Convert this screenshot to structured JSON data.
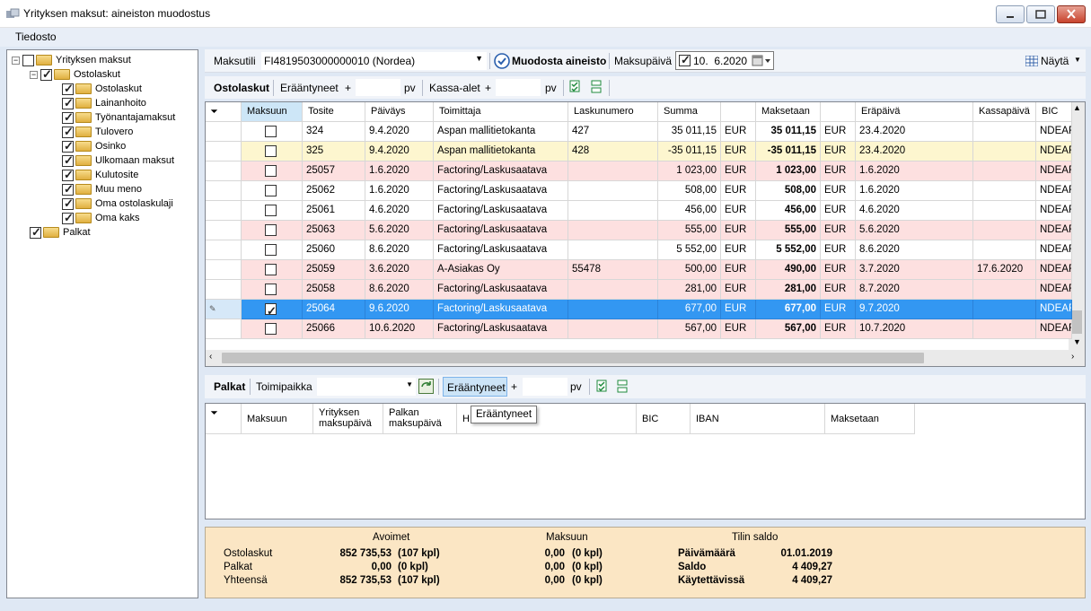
{
  "window": {
    "title": "Yrityksen maksut: aineiston muodostus"
  },
  "menu": {
    "file": "Tiedosto"
  },
  "tree": [
    {
      "label": "Yrityksen maksut",
      "checked": false,
      "level": 0,
      "expander": "−"
    },
    {
      "label": "Ostolaskut",
      "checked": true,
      "level": 1,
      "expander": "−"
    },
    {
      "label": "Ostolaskut",
      "checked": true,
      "level": 2
    },
    {
      "label": "Lainanhoito",
      "checked": true,
      "level": 2
    },
    {
      "label": "Työnantajamaksut",
      "checked": true,
      "level": 2
    },
    {
      "label": "Tulovero",
      "checked": true,
      "level": 2
    },
    {
      "label": "Osinko",
      "checked": true,
      "level": 2
    },
    {
      "label": "Ulkomaan maksut",
      "checked": true,
      "level": 2
    },
    {
      "label": "Kulutosite",
      "checked": true,
      "level": 2
    },
    {
      "label": "Muu meno",
      "checked": true,
      "level": 2
    },
    {
      "label": "Oma ostolaskulaji",
      "checked": true,
      "level": 2
    },
    {
      "label": "Oma kaks",
      "checked": true,
      "level": 2
    },
    {
      "label": "Palkat",
      "checked": true,
      "level": 1
    }
  ],
  "top": {
    "account_label": "Maksutili",
    "account_value": "FI4819503000000010 (Nordea)",
    "create_label": "Muodosta aineisto",
    "paydate_label": "Maksupäivä",
    "paydate_value": "10.  6.2020",
    "show_label": "Näytä"
  },
  "purchases": {
    "section_label": "Ostolaskut",
    "overdue_label": "Erääntyneet",
    "plus": "+",
    "pv": "pv",
    "discount_label": "Kassa-alet",
    "plus2": "+",
    "pv2": "pv",
    "columns": [
      "Maksuun",
      "Tosite",
      "Päiväys",
      "Toimittaja",
      "Laskunumero",
      "Summa",
      "",
      "Maksetaan",
      "",
      "Eräpäivä",
      "Kassapäivä",
      "BIC"
    ],
    "rows": [
      {
        "checked": false,
        "doc": "324",
        "date": "9.4.2020",
        "supplier": "Aspan mallitietokanta",
        "invoice": "427",
        "sum": "35 011,15",
        "cur": "EUR",
        "pay": "35 011,15",
        "cur2": "EUR",
        "due": "23.4.2020",
        "cash": "",
        "bic": "NDEAFIHH",
        "style": "white",
        "due_red": true
      },
      {
        "checked": false,
        "doc": "325",
        "date": "9.4.2020",
        "supplier": "Aspan mallitietokanta",
        "invoice": "428",
        "sum": "-35 011,15",
        "cur": "EUR",
        "pay": "-35 011,15",
        "cur2": "EUR",
        "due": "23.4.2020",
        "cash": "",
        "bic": "NDEAFIHH",
        "style": "yellow",
        "due_red": true
      },
      {
        "checked": false,
        "doc": "25057",
        "date": "1.6.2020",
        "supplier": "Factoring/Laskusaatava",
        "invoice": "",
        "sum": "1 023,00",
        "cur": "EUR",
        "pay": "1 023,00",
        "cur2": "EUR",
        "due": "1.6.2020",
        "cash": "",
        "bic": "NDEAFIHH",
        "style": "pink",
        "due_red": true
      },
      {
        "checked": false,
        "doc": "25062",
        "date": "1.6.2020",
        "supplier": "Factoring/Laskusaatava",
        "invoice": "",
        "sum": "508,00",
        "cur": "EUR",
        "pay": "508,00",
        "cur2": "EUR",
        "due": "1.6.2020",
        "cash": "",
        "bic": "NDEAFIHH",
        "style": "white",
        "due_red": true
      },
      {
        "checked": false,
        "doc": "25061",
        "date": "4.6.2020",
        "supplier": "Factoring/Laskusaatava",
        "invoice": "",
        "sum": "456,00",
        "cur": "EUR",
        "pay": "456,00",
        "cur2": "EUR",
        "due": "4.6.2020",
        "cash": "",
        "bic": "NDEAFIHH",
        "style": "white",
        "due_red": true
      },
      {
        "checked": false,
        "doc": "25063",
        "date": "5.6.2020",
        "supplier": "Factoring/Laskusaatava",
        "invoice": "",
        "sum": "555,00",
        "cur": "EUR",
        "pay": "555,00",
        "cur2": "EUR",
        "due": "5.6.2020",
        "cash": "",
        "bic": "NDEAFIHH",
        "style": "pink",
        "due_red": true
      },
      {
        "checked": false,
        "doc": "25060",
        "date": "8.6.2020",
        "supplier": "Factoring/Laskusaatava",
        "invoice": "",
        "sum": "5 552,00",
        "cur": "EUR",
        "pay": "5 552,00",
        "cur2": "EUR",
        "due": "8.6.2020",
        "cash": "",
        "bic": "NDEAFIHH",
        "style": "white",
        "due_red": true
      },
      {
        "checked": false,
        "doc": "25059",
        "date": "3.6.2020",
        "supplier": "A-Asiakas Oy",
        "invoice": "55478",
        "sum": "500,00",
        "cur": "EUR",
        "pay": "490,00",
        "cur2": "EUR",
        "due": "3.7.2020",
        "cash": "17.6.2020",
        "bic": "NDEAFIHH",
        "style": "pink",
        "due_red": false
      },
      {
        "checked": false,
        "doc": "25058",
        "date": "8.6.2020",
        "supplier": "Factoring/Laskusaatava",
        "invoice": "",
        "sum": "281,00",
        "cur": "EUR",
        "pay": "281,00",
        "cur2": "EUR",
        "due": "8.7.2020",
        "cash": "",
        "bic": "NDEAFIHH",
        "style": "pink",
        "due_red": false
      },
      {
        "checked": true,
        "doc": "25064",
        "date": "9.6.2020",
        "supplier": "Factoring/Laskusaatava",
        "invoice": "",
        "sum": "677,00",
        "cur": "EUR",
        "pay": "677,00",
        "cur2": "EUR",
        "due": "9.7.2020",
        "cash": "",
        "bic": "NDEAFIHH",
        "style": "selected",
        "due_red": false
      },
      {
        "checked": false,
        "doc": "25066",
        "date": "10.6.2020",
        "supplier": "Factoring/Laskusaatava",
        "invoice": "",
        "sum": "567,00",
        "cur": "EUR",
        "pay": "567,00",
        "cur2": "EUR",
        "due": "10.7.2020",
        "cash": "",
        "bic": "NDEAFIHH",
        "style": "pink",
        "due_red": false
      }
    ]
  },
  "salaries": {
    "section_label": "Palkat",
    "location_label": "Toimipaikka",
    "overdue_label": "Erääntyneet",
    "plus": "+",
    "pv": "pv",
    "tooltip": "Erääntyneet",
    "columns": [
      "Maksuun",
      "Yrityksen maksupäivä",
      "Palkan maksupäivä",
      "H",
      "BIC",
      "IBAN",
      "Maksetaan"
    ]
  },
  "summary": {
    "open_header": "Avoimet",
    "topay_header": "Maksuun",
    "balance_header": "Tilin saldo",
    "rows": [
      {
        "label": "Ostolaskut",
        "open": "852 735,53",
        "open_cnt": "(107 kpl)",
        "pay": "0,00",
        "pay_cnt": "(0 kpl)"
      },
      {
        "label": "Palkat",
        "open": "0,00",
        "open_cnt": "(0 kpl)",
        "pay": "0,00",
        "pay_cnt": "(0 kpl)"
      },
      {
        "label": "Yhteensä",
        "open": "852 735,53",
        "open_cnt": "(107 kpl)",
        "pay": "0,00",
        "pay_cnt": "(0 kpl)"
      }
    ],
    "balance": [
      {
        "label": "Päivämäärä",
        "value": "01.01.2019"
      },
      {
        "label": "Saldo",
        "value": "4 409,27"
      },
      {
        "label": "Käytettävissä",
        "value": "4 409,27"
      }
    ]
  }
}
